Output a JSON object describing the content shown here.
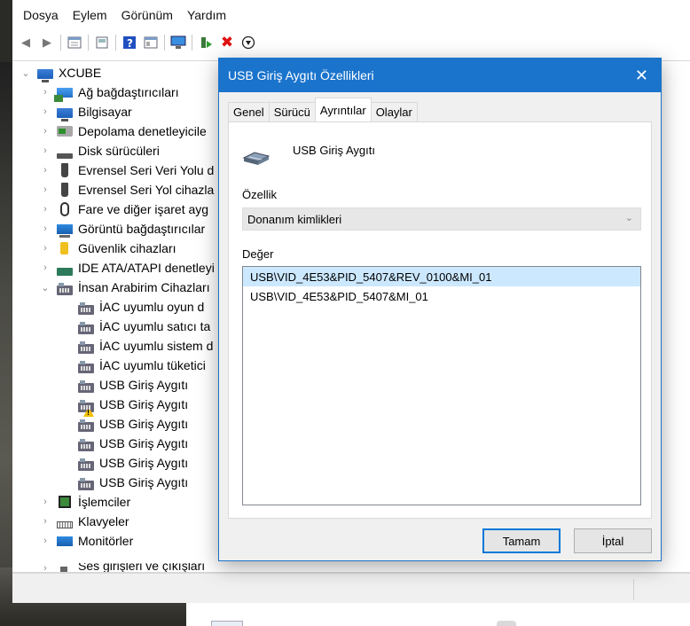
{
  "menu": [
    "Dosya",
    "Eylem",
    "Görünüm",
    "Yardım"
  ],
  "toolbar_icons": [
    "back-arrow-icon",
    "forward-arrow-icon",
    "properties-grid-icon",
    "properties-page-icon",
    "help-icon",
    "view-grid-icon",
    "monitor-scan-icon",
    "enable-device-icon",
    "remove-device-icon",
    "update-driver-icon"
  ],
  "tree": {
    "root": "XCUBE",
    "categories": [
      {
        "label": "Ağ bağdaştırıcıları",
        "icon": "network-adapter-icon"
      },
      {
        "label": "Bilgisayar",
        "icon": "computer-icon"
      },
      {
        "label": "Depolama denetleyicile",
        "icon": "storage-controller-icon"
      },
      {
        "label": "Disk sürücüleri",
        "icon": "disk-drive-icon"
      },
      {
        "label": "Evrensel Seri Veri Yolu d",
        "icon": "usb-connector-icon"
      },
      {
        "label": "Evrensel Seri Yol cihazla",
        "icon": "usb-connector-icon"
      },
      {
        "label": "Fare ve diğer işaret ayg",
        "icon": "mouse-icon"
      },
      {
        "label": "Görüntü bağdaştırıcılar",
        "icon": "display-adapter-icon"
      },
      {
        "label": "Güvenlik cihazları",
        "icon": "security-key-icon"
      },
      {
        "label": "IDE ATA/ATAPI denetleyi",
        "icon": "ide-controller-icon"
      },
      {
        "label": "İnsan Arabirim Cihazları",
        "icon": "hid-icon"
      }
    ],
    "hid_children": [
      {
        "label": "İAC uyumlu oyun d",
        "warning": false
      },
      {
        "label": "İAC uyumlu satıcı ta",
        "warning": false
      },
      {
        "label": "İAC uyumlu sistem d",
        "warning": false
      },
      {
        "label": "İAC uyumlu tüketici",
        "warning": false
      },
      {
        "label": "USB Giriş Aygıtı",
        "warning": false
      },
      {
        "label": "USB Giriş Aygıtı",
        "warning": true
      },
      {
        "label": "USB Giriş Aygıtı",
        "warning": false
      },
      {
        "label": "USB Giriş Aygıtı",
        "warning": false
      },
      {
        "label": "USB Giriş Aygıtı",
        "warning": false
      },
      {
        "label": "USB Giriş Aygıtı",
        "warning": false
      }
    ],
    "after": [
      {
        "label": "İşlemciler",
        "icon": "processor-icon"
      },
      {
        "label": "Klavyeler",
        "icon": "keyboard-icon"
      },
      {
        "label": "Monitörler",
        "icon": "monitor-icon"
      },
      {
        "label": "Ses girişleri ve çıkışları",
        "icon": "audio-io-icon"
      }
    ]
  },
  "dialog": {
    "title": "USB Giriş Aygıtı Özellikleri",
    "tabs": [
      "Genel",
      "Sürücü",
      "Ayrıntılar",
      "Olaylar"
    ],
    "active_tab": "Ayrıntılar",
    "device_name": "USB Giriş Aygıtı",
    "property_label": "Özellik",
    "property_value": "Donanım kimlikleri",
    "value_label": "Değer",
    "values": [
      "USB\\VID_4E53&PID_5407&REV_0100&MI_01",
      "USB\\VID_4E53&PID_5407&MI_01"
    ],
    "ok_label": "Tamam",
    "cancel_label": "İptal"
  },
  "colors": {
    "title_bar": "#1b74cc",
    "selection": "#cce8ff",
    "warning": "#f2c200"
  }
}
